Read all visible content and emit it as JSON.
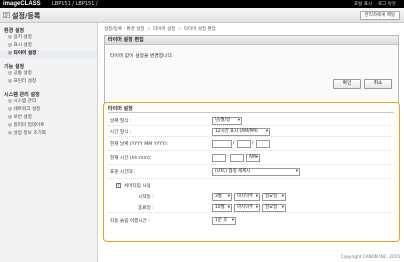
{
  "topbar": {
    "brand": "imageCLASS",
    "model": "LBP151 / LBP151 /",
    "links": [
      "포털 표시",
      "로그 아웃"
    ]
  },
  "titlebar": {
    "title": "설정/등록",
    "mail_button": "관리자에게 메일"
  },
  "sidebar": {
    "sections": [
      {
        "heading": "환경 설정",
        "items": [
          "◎ 용지 설정",
          "◎ 표시 설정",
          "◎ 타이머 설정"
        ]
      },
      {
        "heading": "기능 설정",
        "items": [
          "◎ 공통 설정",
          "◎ 프린터 설정"
        ]
      },
      {
        "heading": "시스템 관리 설정",
        "items": [
          "◎ 시스템 관리",
          "◎ 네트워크 설정",
          "◎ 보안 설정",
          "◎ 컬러미 업데이트",
          "◎ 설정 정보 초기화"
        ]
      }
    ],
    "active_item": "◎ 타이머 설정"
  },
  "breadcrumb": {
    "items": [
      "설정/등록 : 환경 설정",
      "타이머 설정",
      "타이머 설정 편집"
    ]
  },
  "panel": {
    "heading": "타이머 설정 편집",
    "message": "타이머 값이 설정을 변경합니다.",
    "ok_label": "확인",
    "cancel_label": "취소"
  },
  "timer": {
    "heading": "타이머 설정",
    "date_format_label": "날짜 형식 :",
    "date_format_value": "년/월/일",
    "time_format_label": "시간 형식 :",
    "time_format_value": "12시간 표시 (AM/PM)",
    "current_date_label": "현재 날짜 (YYYY MM YYYY):",
    "current_time_label": "현재 시간 (hh:mm):",
    "time_ampm": "AM",
    "timezone_label": "표준 시간대 :",
    "timezone_value": "(UTC) 협정 세계시",
    "dst_label": "서머타임 사용",
    "start_label": "시작일 :",
    "start_month": "3월",
    "start_week": "마지막주",
    "start_day": "일요일",
    "end_label": "종료일 :",
    "end_month": "10월",
    "end_week": "마지막주",
    "end_day": "일요일",
    "auto_sleep_label": "자동 슬립 이행시간 :",
    "auto_sleep_value": "1분 후"
  },
  "footer": {
    "copyright": "Copyright CANON INC. 2015"
  }
}
